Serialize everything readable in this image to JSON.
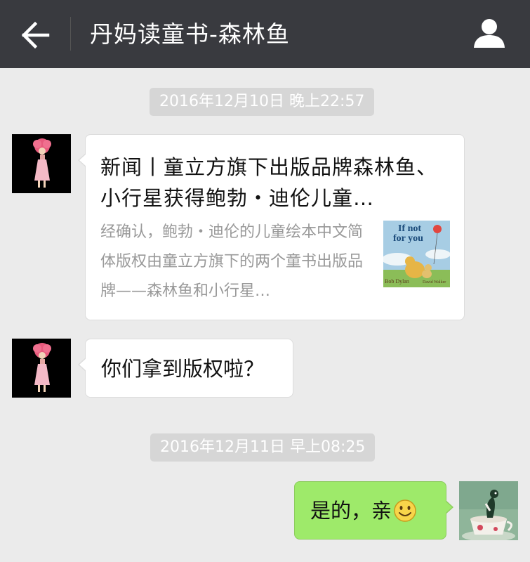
{
  "header": {
    "title": "丹妈读童书-森林鱼",
    "back_icon": "back-arrow-icon",
    "profile_icon": "person-icon"
  },
  "messages": [
    {
      "timestamp": "2016年12月10日 晚上22:57",
      "sender": "left",
      "type": "article-card",
      "title": "新闻丨童立方旗下出版品牌森林鱼、小行星获得鲍勃・迪伦儿童…",
      "description": "经确认，鲍勃・迪伦的儿童绘本中文简体版权由童立方旗下的两个童书出版品牌——森林鱼和小行星…",
      "thumbnail": {
        "title_line1": "If not",
        "title_line2": "for you",
        "author": "Bob Dylan",
        "illustrator": "David Walker"
      }
    },
    {
      "sender": "left",
      "type": "text",
      "text": "你们拿到版权啦？"
    },
    {
      "timestamp": "2016年12月11日 早上08:25",
      "sender": "right",
      "type": "text",
      "text": "是的，亲",
      "emoji": "smiley-icon"
    }
  ],
  "colors": {
    "header_bg": "#393a3f",
    "chat_bg": "#ebebeb",
    "outgoing_bubble": "#9eea6a",
    "incoming_bubble": "#ffffff",
    "timestamp_bg": "#d6d6d6"
  }
}
